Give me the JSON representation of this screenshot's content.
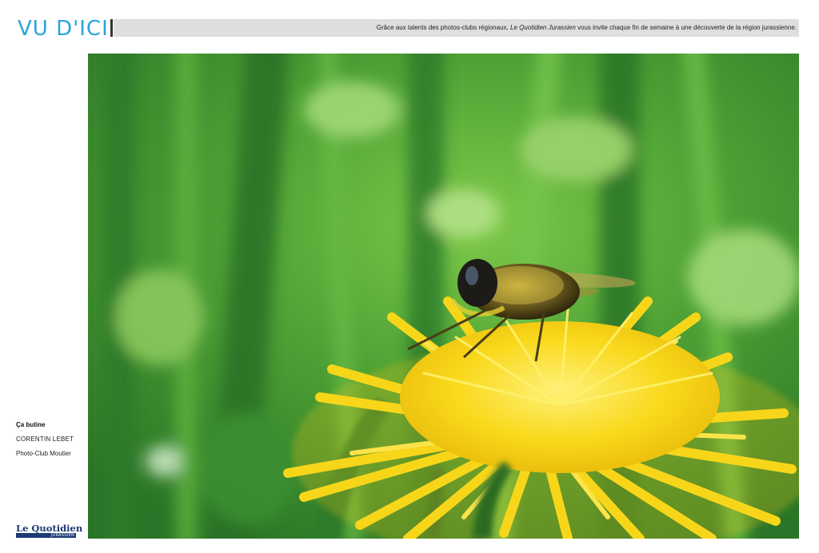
{
  "header": {
    "section_title": "VU D'ICI",
    "intro_before": "Grâce aux talents des photos-clubs régionaux, ",
    "intro_paper": "Le Quotidien Jurassien",
    "intro_after": " vous invite chaque fin de semaine à une découverte de la région jurassienne."
  },
  "caption": {
    "title": "Ça butine",
    "author": "CORENTIN LEBET",
    "club": "Photo-Club Moutier"
  },
  "logo": {
    "name": "Le Quotidien",
    "sub": "JURASSIEN"
  },
  "colors": {
    "accent": "#29a3dc",
    "header_band": "#dedede",
    "logo_blue": "#1c3a73",
    "flower_yellow": "#f7d61a",
    "background_green": "#3f8f2a"
  }
}
